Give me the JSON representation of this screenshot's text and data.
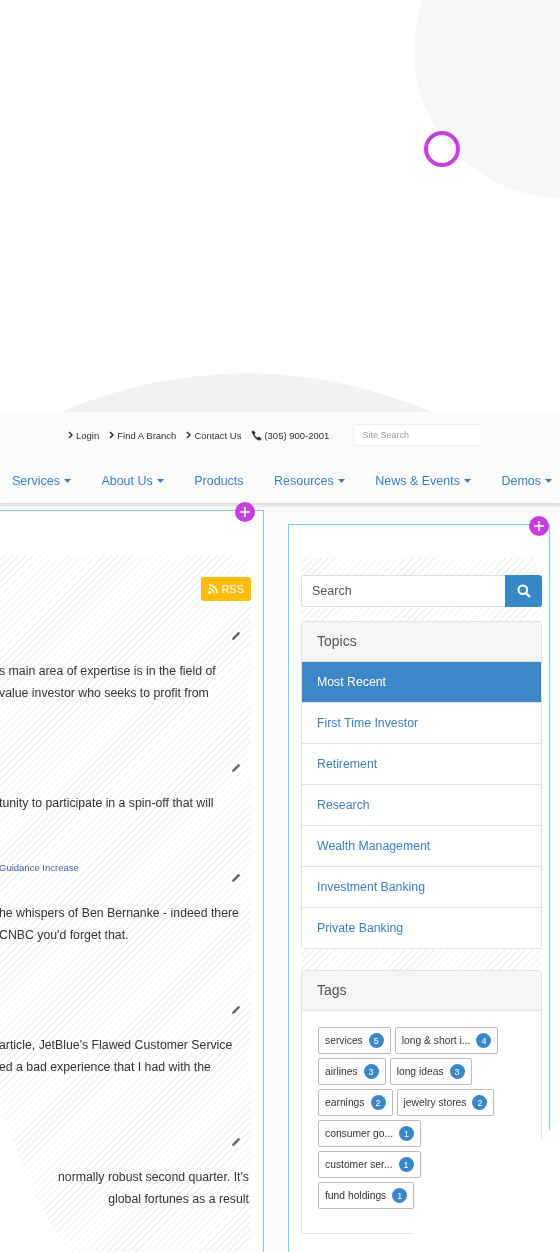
{
  "utility_links": [
    {
      "label": "Login"
    },
    {
      "label": "Find A Branch"
    },
    {
      "label": "Contact Us"
    }
  ],
  "phone": "(305) 900-2001",
  "site_search": {
    "placeholder": "Site Search"
  },
  "nav": [
    {
      "label": "Services",
      "dropdown": true
    },
    {
      "label": "About Us",
      "dropdown": true
    },
    {
      "label": "Products",
      "dropdown": false
    },
    {
      "label": "Resources",
      "dropdown": true
    },
    {
      "label": "News & Events",
      "dropdown": true
    },
    {
      "label": "Demos",
      "dropdown": true
    }
  ],
  "main_panel": {
    "rss": "RSS",
    "articles": [
      {
        "lines": [
          "s main area of expertise is in the field of",
          "value investor who seeks to profit from"
        ]
      },
      {
        "lines": [
          "tunity to participate in a spin-off that will"
        ]
      },
      {
        "category": "Guidance Increase",
        "lines": [
          "he whispers of Ben Bernanke - indeed there",
          "CNBC you'd forget that."
        ]
      },
      {
        "lines": [
          "article, JetBlue's Flawed Customer Service",
          "ed a bad experience that I had with the"
        ]
      },
      {
        "lines": [
          "normally robust second quarter. It's",
          "global fortunes as a result"
        ]
      }
    ]
  },
  "sidebar": {
    "search": {
      "placeholder": "Search"
    },
    "topics": {
      "title": "Topics",
      "items": [
        {
          "label": "Most Recent",
          "selected": true
        },
        {
          "label": "First Time Investor",
          "selected": false
        },
        {
          "label": "Retirement",
          "selected": false
        },
        {
          "label": "Research",
          "selected": false
        },
        {
          "label": "Wealth Management",
          "selected": false
        },
        {
          "label": "Investment Banking",
          "selected": false
        },
        {
          "label": "Private Banking",
          "selected": false
        }
      ]
    },
    "tags": {
      "title": "Tags",
      "items": [
        {
          "label": "services",
          "count": "5"
        },
        {
          "label": "long & short i...",
          "count": "4"
        },
        {
          "label": "airlines",
          "count": "3"
        },
        {
          "label": "long ideas",
          "count": "3"
        },
        {
          "label": "earnings",
          "count": "2"
        },
        {
          "label": "jewelry stores",
          "count": "2"
        },
        {
          "label": "consumer go...",
          "count": "1"
        },
        {
          "label": "customer ser...",
          "count": "1"
        },
        {
          "label": "fund holdings",
          "count": "1"
        }
      ]
    }
  }
}
